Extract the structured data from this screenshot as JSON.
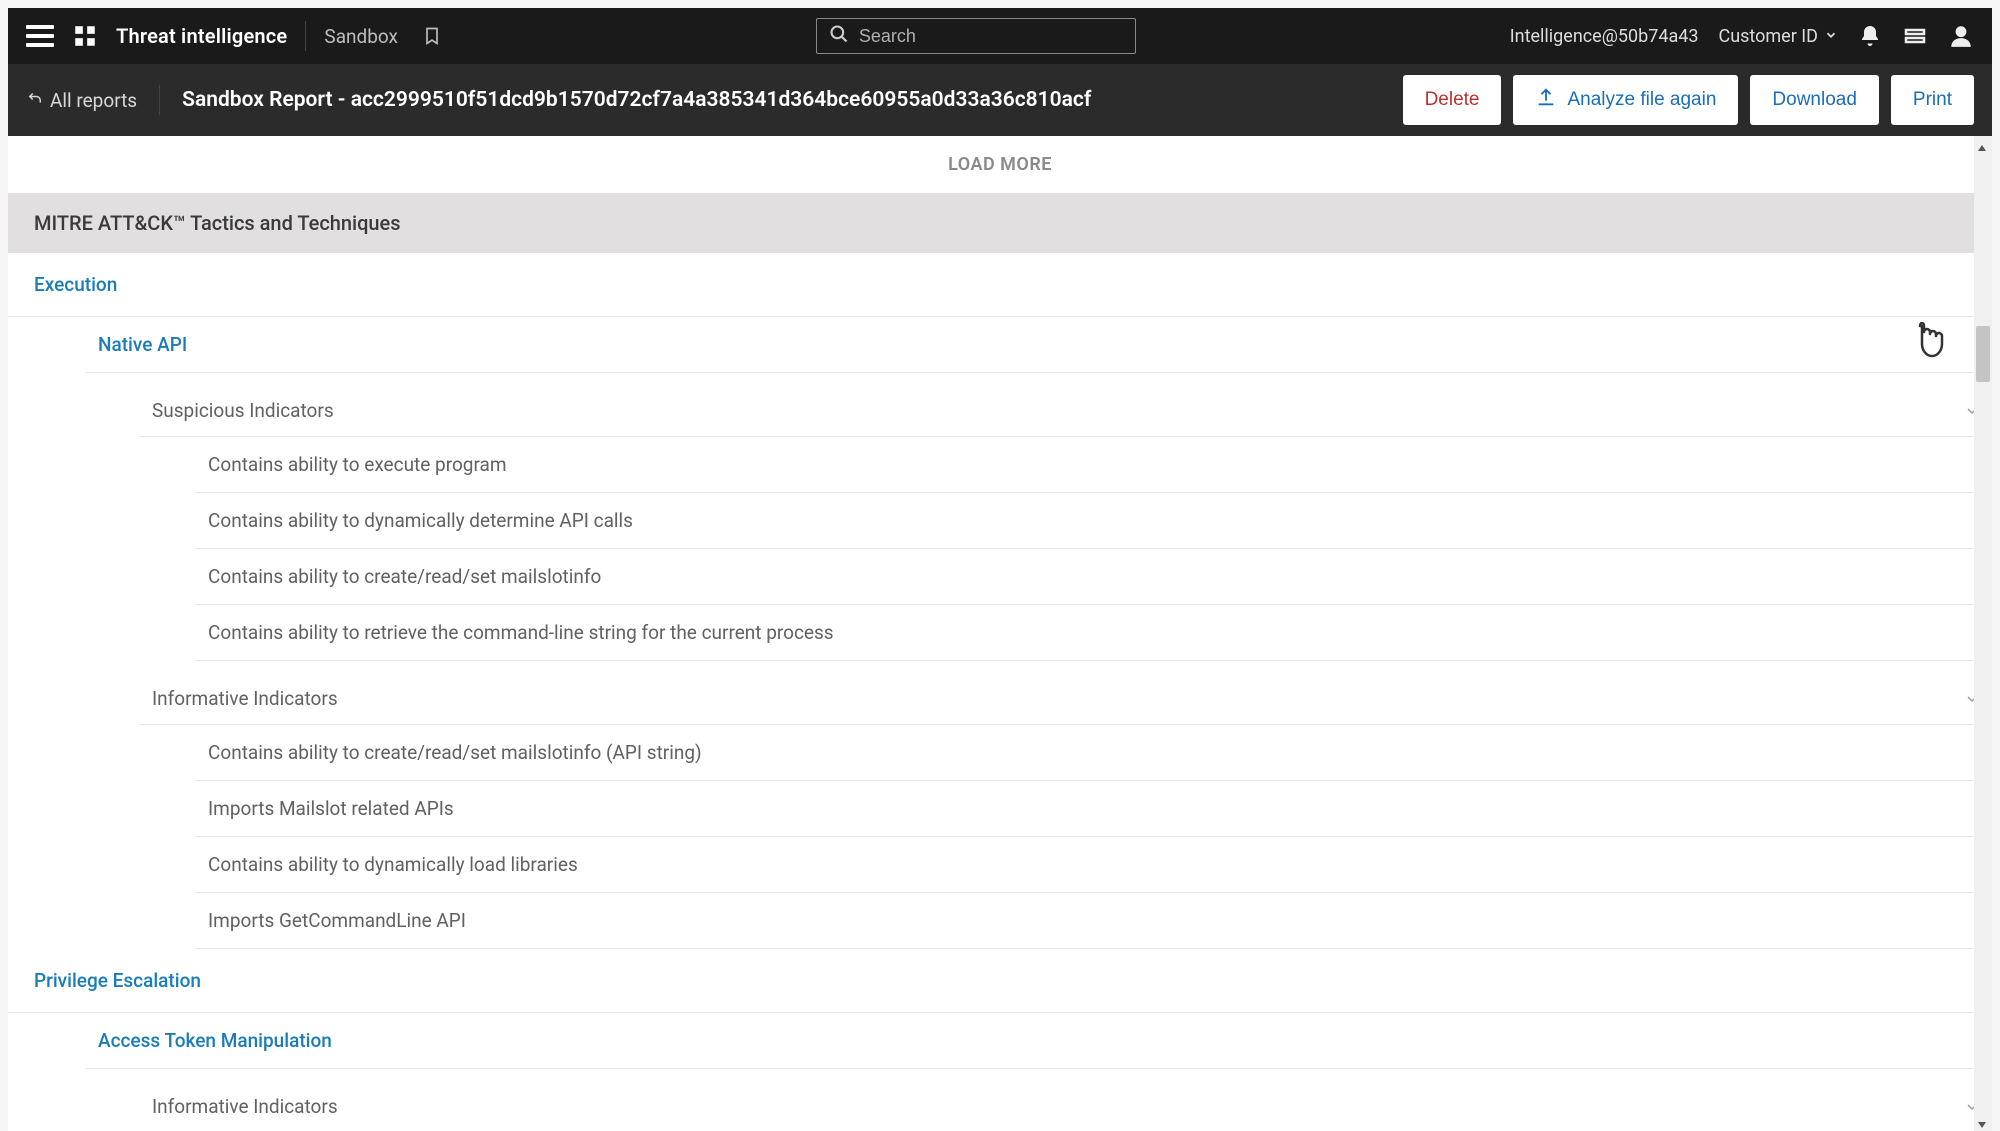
{
  "header": {
    "brand": "Threat intelligence",
    "crumb": "Sandbox",
    "search_placeholder": "Search",
    "tenant": "Intelligence@50b74a43",
    "customer_id_label": "Customer ID"
  },
  "subheader": {
    "all_reports": "All reports",
    "report_title": "Sandbox Report - acc2999510f51dcd9b1570d72cf7a4a385341d364bce60955a0d33a36c810acf",
    "buttons": {
      "delete": "Delete",
      "analyze": "Analyze file again",
      "download": "Download",
      "print": "Print"
    }
  },
  "main": {
    "load_more": "LOAD MORE",
    "section_title": "MITRE ATT&CK™ Tactics and Techniques",
    "tactics": [
      {
        "name": "Execution",
        "techniques": [
          {
            "name": "Native API",
            "groups": [
              {
                "name": "Suspicious Indicators",
                "indicators": [
                  "Contains ability to execute program",
                  "Contains ability to dynamically determine API calls",
                  "Contains ability to create/read/set mailslotinfo",
                  "Contains ability to retrieve the command-line string for the current process"
                ]
              },
              {
                "name": "Informative Indicators",
                "indicators": [
                  "Contains ability to create/read/set mailslotinfo (API string)",
                  "Imports Mailslot related APIs",
                  "Contains ability to dynamically load libraries",
                  "Imports GetCommandLine API"
                ]
              }
            ]
          }
        ]
      },
      {
        "name": "Privilege Escalation",
        "techniques": [
          {
            "name": "Access Token Manipulation",
            "groups": [
              {
                "name": "Informative Indicators",
                "indicators": []
              }
            ]
          }
        ]
      }
    ]
  }
}
